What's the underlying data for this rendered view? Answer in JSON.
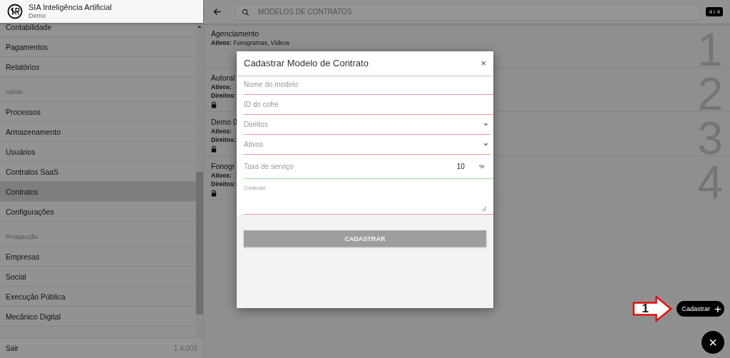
{
  "app": {
    "title": "SIA Inteligência Artificial",
    "subtitle": "Demo"
  },
  "sidebar": {
    "items": [
      {
        "kind": "item",
        "label": "Contabilidade",
        "selected": false
      },
      {
        "kind": "item",
        "label": "Pagamentos",
        "selected": false
      },
      {
        "kind": "item",
        "label": "Relatórios",
        "selected": false
      },
      {
        "kind": "heading",
        "label": "Admin"
      },
      {
        "kind": "item",
        "label": "Processos",
        "selected": false
      },
      {
        "kind": "item",
        "label": "Armazenamento",
        "selected": false
      },
      {
        "kind": "item",
        "label": "Usuários",
        "selected": false
      },
      {
        "kind": "item",
        "label": "Contratos SaaS",
        "selected": false
      },
      {
        "kind": "item",
        "label": "Contratos",
        "selected": true
      },
      {
        "kind": "item",
        "label": "Configurações",
        "selected": false
      },
      {
        "kind": "heading",
        "label": "Prospecção"
      },
      {
        "kind": "item",
        "label": "Empresas",
        "selected": false
      },
      {
        "kind": "item",
        "label": "Social",
        "selected": false
      },
      {
        "kind": "item",
        "label": "Execução Pública",
        "selected": false
      },
      {
        "kind": "item",
        "label": "Mecânico Digital",
        "selected": false
      }
    ],
    "footer": {
      "logout": "Sair",
      "version": "1.4.009"
    }
  },
  "search": {
    "placeholder": "MODELOS DE CONTRATOS",
    "count": "4 / 4"
  },
  "contracts": [
    {
      "name": "Agenciamento",
      "assets_label": "Ativos:",
      "assets": "Fonogramas, Vídeos",
      "locked": false,
      "number": "1"
    },
    {
      "name": "Autoral",
      "assets_label": "Ativos:",
      "rights_label": "Direitos:",
      "locked": true,
      "number": "2"
    },
    {
      "name": "Demo 0",
      "assets_label": "Ativos:",
      "rights_label": "Direitos:",
      "locked": true,
      "number": "3"
    },
    {
      "name": "Fonogr",
      "assets_label": "Ativos:",
      "rights_label": "Direitos:",
      "locked": true,
      "number": "4"
    }
  ],
  "modal": {
    "title": "Cadastrar Modelo de Contrato",
    "close": "×",
    "fields": [
      {
        "kind": "text",
        "placeholder": "Nome do modelo",
        "valid": false
      },
      {
        "kind": "text",
        "placeholder": "ID do cofre",
        "valid": false
      },
      {
        "kind": "select",
        "placeholder": "Direitos",
        "valid": false
      },
      {
        "kind": "select",
        "placeholder": "Ativos",
        "valid": false
      },
      {
        "kind": "number",
        "placeholder": "Taxa de serviço",
        "value": "10",
        "suffix": "%",
        "valid": true
      },
      {
        "kind": "textarea",
        "label": "Conteúdo",
        "valid": false
      }
    ],
    "submit": "CADASTRAR"
  },
  "fab": {
    "label": "Cadastrar",
    "plus": "+",
    "close": "×"
  },
  "annotation": {
    "label": "1"
  }
}
